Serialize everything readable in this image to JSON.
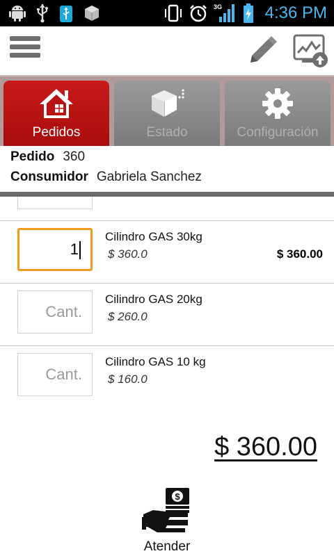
{
  "status_bar": {
    "time": "4:36 PM",
    "network": "3G",
    "icons": [
      "android-icon",
      "usb-icon",
      "usb-storage-icon",
      "box-icon",
      "vibrate-icon",
      "alarm-icon",
      "signal-icon",
      "battery-charging-icon"
    ]
  },
  "action_bar": {
    "menu_icon": "menu-icon",
    "edit_icon": "pencil-icon",
    "upload_icon": "upload-chart-icon"
  },
  "tabs": [
    {
      "label": "Pedidos",
      "icon": "home-icon",
      "active": true
    },
    {
      "label": "Estado",
      "icon": "box-icon",
      "active": false
    },
    {
      "label": "Configuración",
      "icon": "gear-icon",
      "active": false
    }
  ],
  "order": {
    "pedido_label": "Pedido",
    "pedido_value": "360",
    "consumidor_label": "Consumidor",
    "consumidor_value": "Gabriela Sanchez"
  },
  "items": [
    {
      "qty_value": "1",
      "qty_placeholder": "Cant.",
      "name": "Cilindro GAS 30kg",
      "price": "$ 360.0",
      "subtotal": "$ 360.00"
    },
    {
      "qty_value": "",
      "qty_placeholder": "Cant.",
      "name": "Cilindro GAS 20kg",
      "price": "$ 260.0",
      "subtotal": ""
    },
    {
      "qty_value": "",
      "qty_placeholder": "Cant.",
      "name": "Cilindro GAS 10 kg",
      "price": "$ 160.0",
      "subtotal": ""
    }
  ],
  "total": "$ 360.00",
  "atender": {
    "label": "Atender",
    "icon": "cash-hand-icon"
  },
  "colors": {
    "active_tab": "#b81212",
    "inactive_tab": "#8a8a8a",
    "focus_border": "#f0991c",
    "clock": "#49b7ee"
  }
}
